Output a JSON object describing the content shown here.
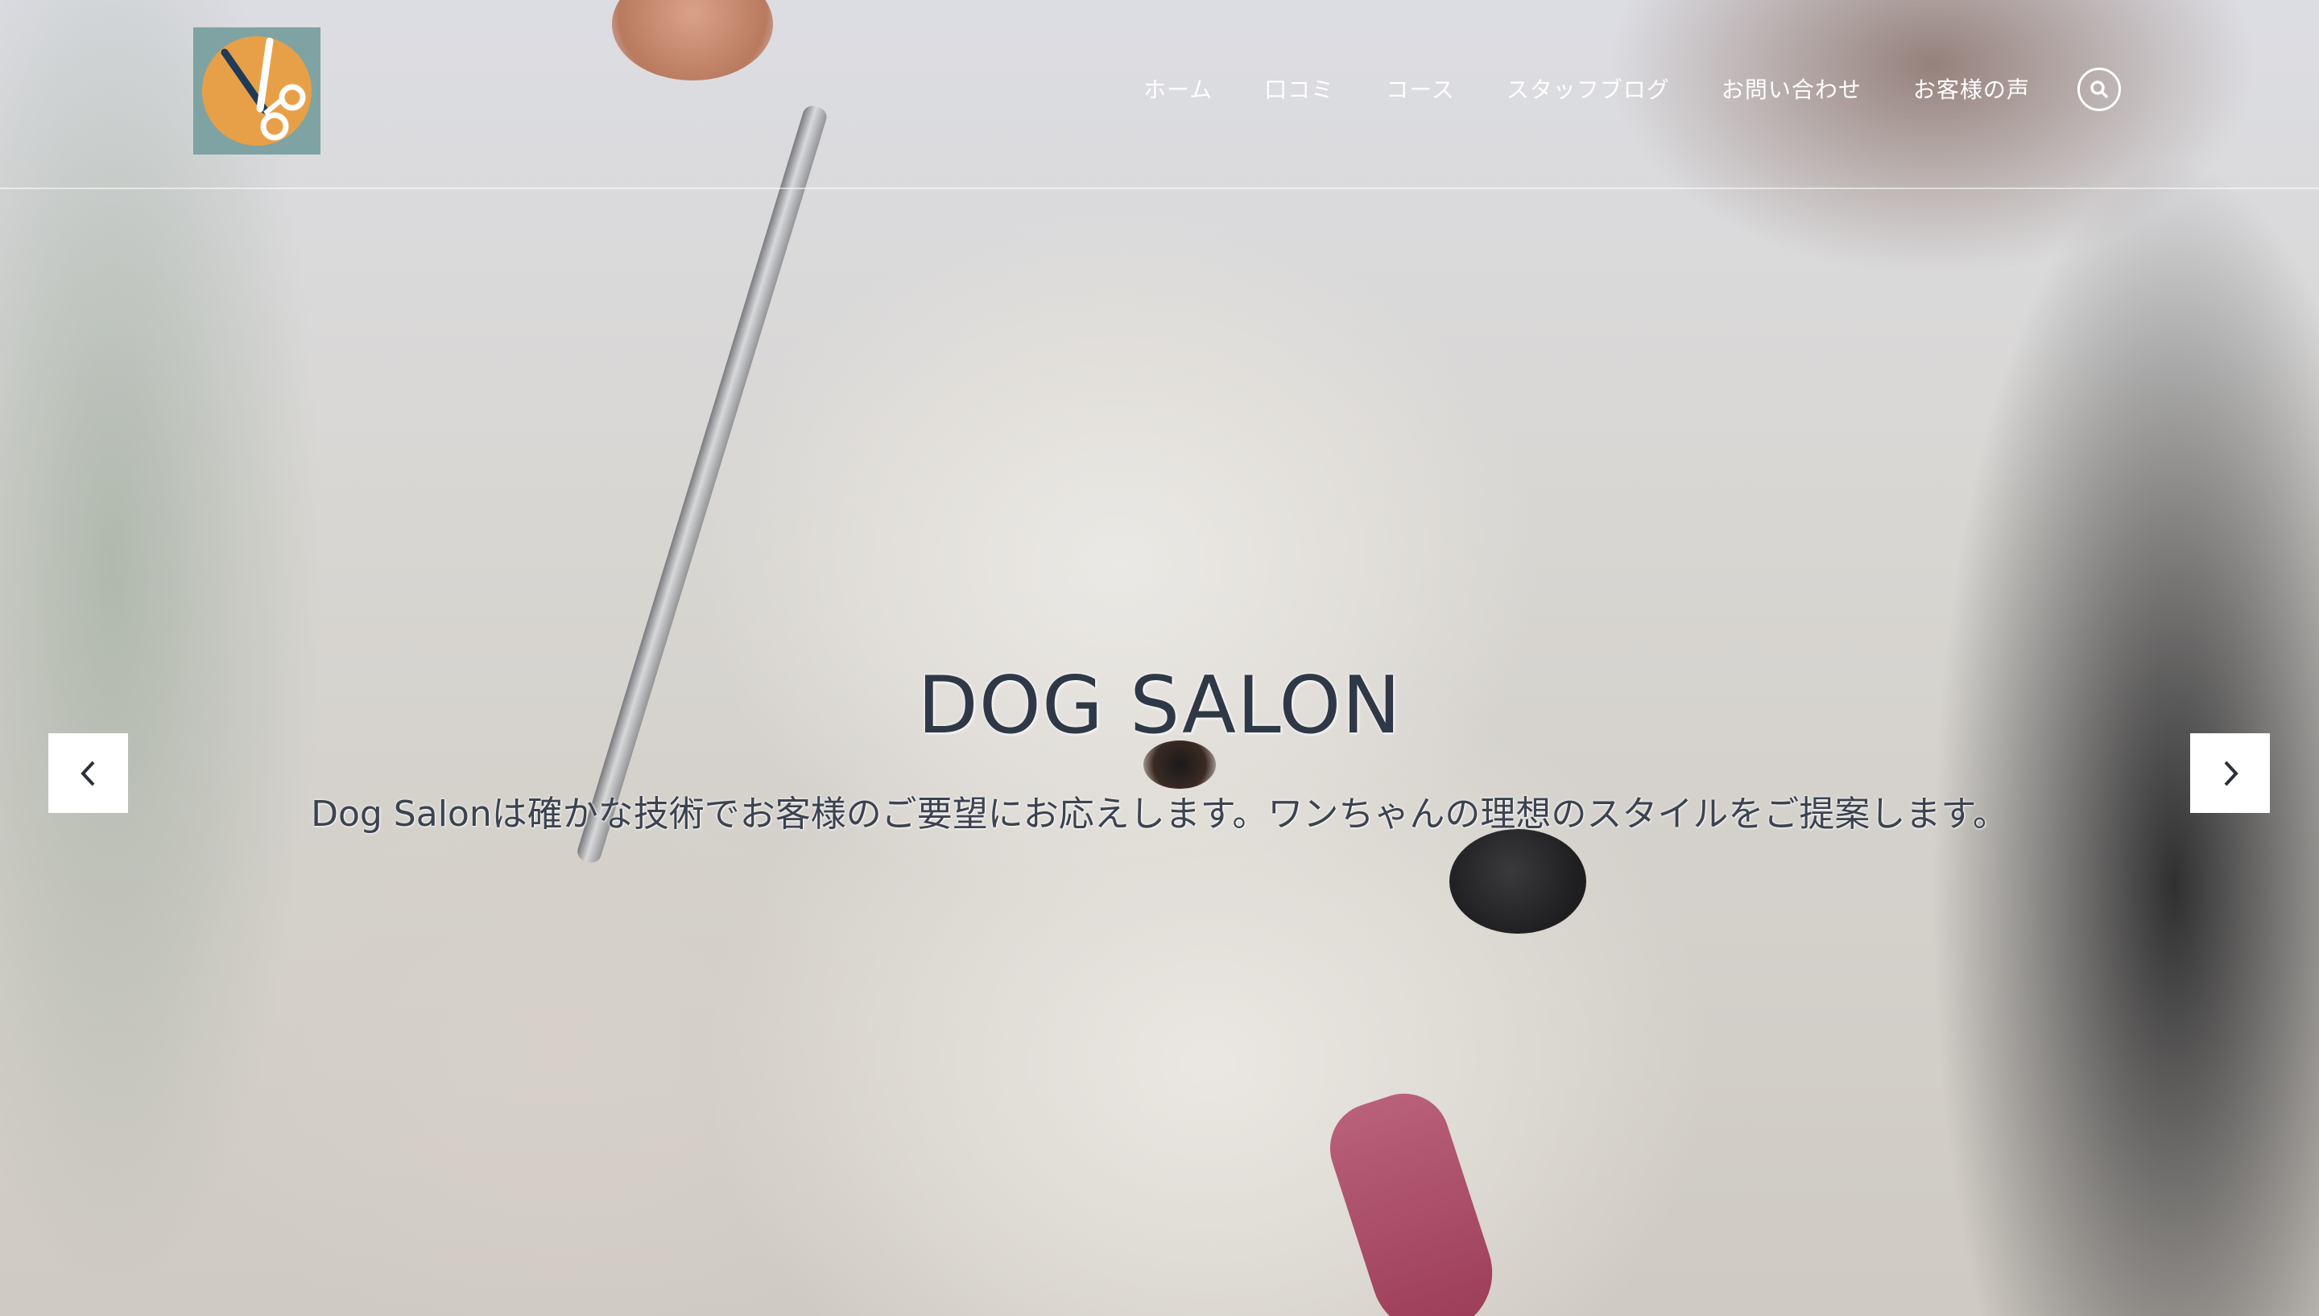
{
  "site": {
    "logo_icon": "scissors-icon",
    "colors": {
      "logo_bg": "#7fa3a3",
      "logo_circle": "#e8a048",
      "caption_title": "#2f3846",
      "nav_text": "#ffffff"
    }
  },
  "nav": {
    "items": [
      {
        "label": "ホーム"
      },
      {
        "label": "口コミ"
      },
      {
        "label": "コース"
      },
      {
        "label": "スタッフブログ"
      },
      {
        "label": "お問い合わせ"
      },
      {
        "label": "お客様の声"
      }
    ],
    "search_icon": "search-icon"
  },
  "slider": {
    "title": "DOG SALON",
    "text": "Dog Salonは確かな技術でお客様のご要望にお応えします。ワンちゃんの理想のスタイルをご提案します。",
    "prev_icon": "chevron-left-icon",
    "next_icon": "chevron-right-icon"
  }
}
